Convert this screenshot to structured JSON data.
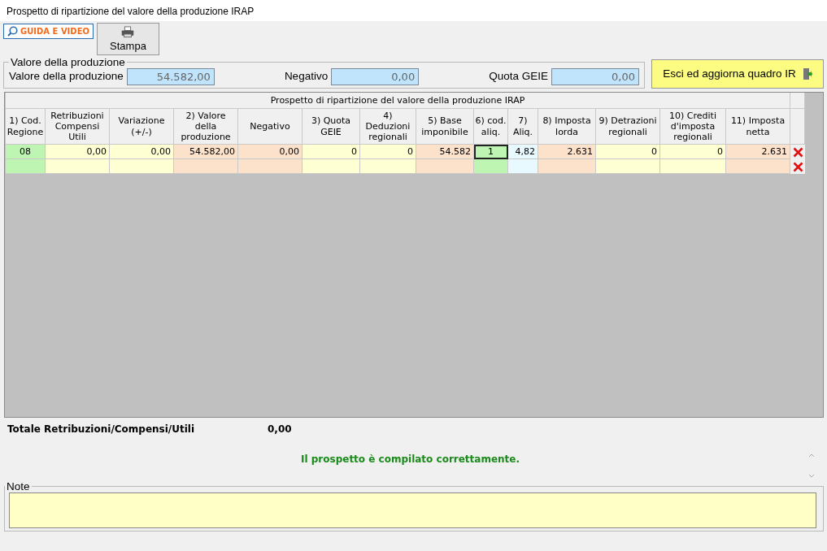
{
  "window": {
    "title": "Prospetto di ripartizione del valore della produzione IRAP"
  },
  "toolbar": {
    "guide_button": "GUIDA E VIDEO",
    "print_button": "Stampa"
  },
  "production_group": {
    "legend": "Valore della produzione",
    "fields": [
      {
        "label": "Valore della produzione",
        "value": "54.582,00"
      },
      {
        "label": "Negativo",
        "value": "0,00"
      },
      {
        "label": "Quota GEIE",
        "value": "0,00"
      }
    ]
  },
  "exit_button": "Esci ed aggiorna quadro IR",
  "table": {
    "title": "Prospetto di ripartizione del valore della produzione IRAP",
    "columns": [
      {
        "label": "1) Cod. Regione",
        "kind": "code"
      },
      {
        "label": "Retribuzioni Compensi Utili",
        "kind": "input"
      },
      {
        "label": "Variazione (+/-)",
        "kind": "input"
      },
      {
        "label": "2) Valore della produzione",
        "kind": "computed"
      },
      {
        "label": "Negativo",
        "kind": "computed"
      },
      {
        "label": "3) Quota GEIE",
        "kind": "input"
      },
      {
        "label": "4) Deduzioni regionali",
        "kind": "input"
      },
      {
        "label": "5) Base imponibile",
        "kind": "computed"
      },
      {
        "label": "6) cod. aliq.",
        "kind": "code"
      },
      {
        "label": "7) Aliq.",
        "kind": "rate"
      },
      {
        "label": "8) Imposta lorda",
        "kind": "computed"
      },
      {
        "label": "9) Detrazioni regionali",
        "kind": "input"
      },
      {
        "label": "10) Crediti d'imposta regionali",
        "kind": "input"
      },
      {
        "label": "11) Imposta netta",
        "kind": "computed"
      }
    ],
    "rows": [
      {
        "kind": "data",
        "cells": [
          {
            "value": "08",
            "selected": false
          },
          {
            "value": "0,00",
            "selected": false
          },
          {
            "value": "0,00",
            "selected": false
          },
          {
            "value": "54.582,00",
            "selected": false
          },
          {
            "value": "0,00",
            "selected": false
          },
          {
            "value": "0",
            "selected": false
          },
          {
            "value": "0",
            "selected": false
          },
          {
            "value": "54.582",
            "selected": false
          },
          {
            "value": "1",
            "selected": true
          },
          {
            "value": "4,82",
            "selected": false
          },
          {
            "value": "2.631",
            "selected": false
          },
          {
            "value": "0",
            "selected": false
          },
          {
            "value": "0",
            "selected": false
          },
          {
            "value": "2.631",
            "selected": false
          }
        ]
      },
      {
        "kind": "new"
      }
    ]
  },
  "total": {
    "label": "Totale Retribuzioni/Compensi/Utili",
    "value": "0,00"
  },
  "message": "Il prospetto è compilato correttamente.",
  "note": {
    "legend": "Note"
  }
}
